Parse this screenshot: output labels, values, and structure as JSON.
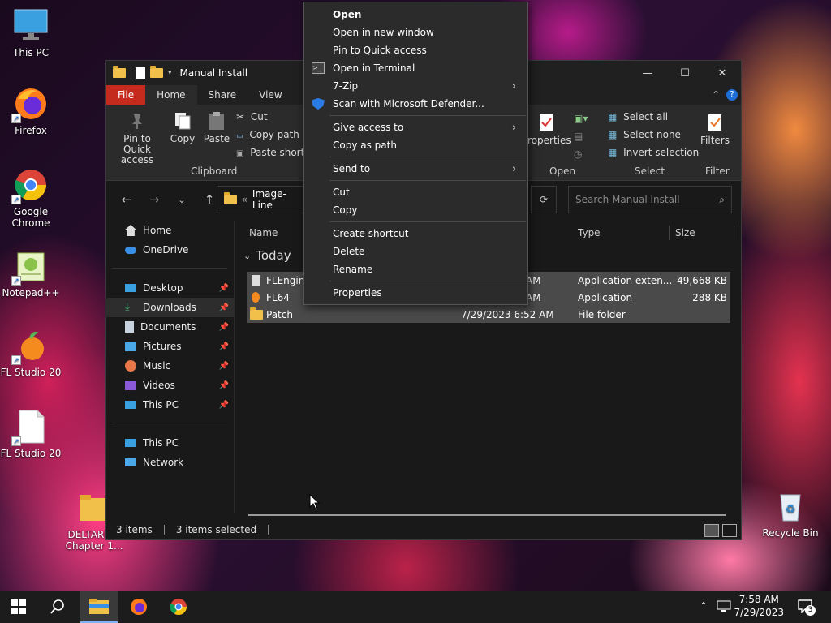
{
  "desktop": {
    "icons": [
      {
        "label": "This PC"
      },
      {
        "label": "Firefox"
      },
      {
        "label": "Google Chrome"
      },
      {
        "label": "Notepad++"
      },
      {
        "label": "FL Studio 20"
      },
      {
        "label": "FL Studio 20"
      },
      {
        "label": "DELTARU... Chapter 1..."
      },
      {
        "label": "Recycle Bin"
      }
    ]
  },
  "window": {
    "title": "Manual Install",
    "controls": {
      "minimize": "—",
      "maximize": "☐",
      "close": "✕"
    },
    "tabs": [
      "File",
      "Home",
      "Share",
      "View"
    ],
    "ribbon": {
      "pin_label": "Pin to Quick access",
      "copy_label": "Copy",
      "paste_label": "Paste",
      "cut_label": "Cut",
      "copy_path_label": "Copy path",
      "paste_shortcut_label": "Paste shortcut",
      "clipboard_group": "Clipboard",
      "properties_label": "Properties",
      "open_group": "Open",
      "select_all": "Select all",
      "select_none": "Select none",
      "invert_selection": "Invert selection",
      "select_group": "Select",
      "filters_label": "Filters",
      "filter_group": "Filter"
    },
    "address": {
      "prefix": "«",
      "path": "Image-Line"
    },
    "search_placeholder": "Search Manual Install",
    "sidebar": {
      "quick": [
        {
          "label": "Home"
        },
        {
          "label": "OneDrive"
        }
      ],
      "pinned": [
        {
          "label": "Desktop"
        },
        {
          "label": "Downloads"
        },
        {
          "label": "Documents"
        },
        {
          "label": "Pictures"
        },
        {
          "label": "Music"
        },
        {
          "label": "Videos"
        },
        {
          "label": "This PC"
        }
      ],
      "bottom": [
        {
          "label": "This PC"
        },
        {
          "label": "Network"
        }
      ]
    },
    "columns": {
      "name": "Name",
      "type": "Type",
      "size": "Size"
    },
    "group": "Today",
    "files": [
      {
        "name": "FLEngine",
        "date": "AM",
        "type": "Application exten...",
        "size": "49,668 KB"
      },
      {
        "name": "FL64",
        "date": "AM",
        "type": "Application",
        "size": "288 KB"
      },
      {
        "name": "Patch",
        "date": "7/29/2023 6:52 AM",
        "type": "File folder",
        "size": ""
      }
    ],
    "status": {
      "items": "3 items",
      "selected": "3 items selected"
    }
  },
  "context_menu": {
    "items": [
      {
        "label": "Open"
      },
      {
        "label": "Open in new window"
      },
      {
        "label": "Pin to Quick access"
      },
      {
        "label": "Open in Terminal"
      },
      {
        "label": "7-Zip"
      },
      {
        "label": "Scan with Microsoft Defender..."
      },
      {
        "label": "Give access to"
      },
      {
        "label": "Copy as path"
      },
      {
        "label": "Send to"
      },
      {
        "label": "Cut"
      },
      {
        "label": "Copy"
      },
      {
        "label": "Create shortcut"
      },
      {
        "label": "Delete"
      },
      {
        "label": "Rename"
      },
      {
        "label": "Properties"
      }
    ]
  },
  "taskbar": {
    "time": "7:58 AM",
    "date": "7/29/2023",
    "notification_count": "3"
  },
  "colors": {
    "accent": "#c42b1c",
    "folder": "#f0c04a"
  }
}
